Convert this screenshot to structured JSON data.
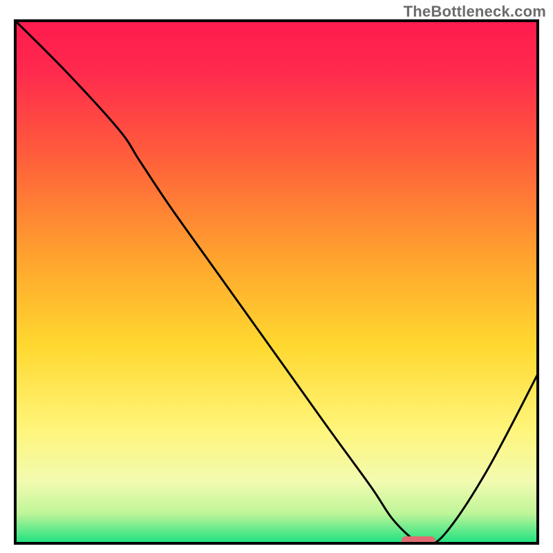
{
  "watermark": "TheBottleneck.com",
  "chart_data": {
    "type": "line",
    "title": "",
    "xlabel": "",
    "ylabel": "",
    "xlim": [
      0,
      100
    ],
    "ylim": [
      0,
      100
    ],
    "grid": false,
    "background": {
      "type": "vertical-gradient",
      "stops": [
        {
          "pct": 0,
          "color": "#ff1a4e"
        },
        {
          "pct": 10,
          "color": "#ff2a4e"
        },
        {
          "pct": 25,
          "color": "#ff5a3c"
        },
        {
          "pct": 45,
          "color": "#ffa22e"
        },
        {
          "pct": 62,
          "color": "#ffd82f"
        },
        {
          "pct": 78,
          "color": "#fff57a"
        },
        {
          "pct": 88,
          "color": "#f2fbb0"
        },
        {
          "pct": 94,
          "color": "#bff599"
        },
        {
          "pct": 100,
          "color": "#15e07e"
        }
      ]
    },
    "series": [
      {
        "name": "bottleneck-curve",
        "color": "#000000",
        "x": [
          0,
          10,
          20,
          24,
          30,
          40,
          50,
          60,
          68,
          72,
          76,
          78,
          82,
          90,
          100
        ],
        "y": [
          100,
          90,
          79,
          73,
          64,
          50,
          36,
          22,
          11,
          5,
          1,
          0,
          2,
          14,
          33
        ]
      }
    ],
    "marker": {
      "name": "optimal-marker",
      "shape": "rounded-rect",
      "color": "#e16b72",
      "x_center": 77,
      "y_center": 0.6,
      "x_halfwidth": 3.2,
      "y_halfheight": 1.0
    }
  }
}
